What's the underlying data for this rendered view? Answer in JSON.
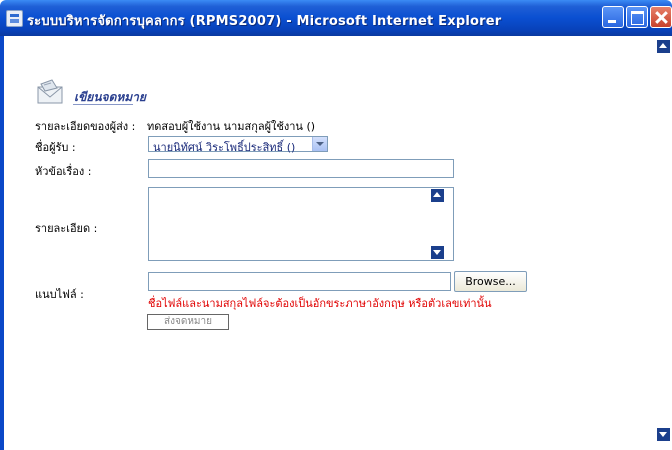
{
  "window": {
    "title": "ระบบบริหารจัดการบุคลากร (RPMS2007) - Microsoft Internet Explorer"
  },
  "page": {
    "heading": "เขียนจดหมาย",
    "sender": {
      "label": "รายละเอียดของผู้ส่ง :",
      "value": "ทดสอบผู้ใช้งาน นามสกุลผู้ใช้งาน ()"
    },
    "recipient": {
      "label": "ชื่อผู้รับ :",
      "selected": "นายนิทัศน์ วิระโพธิ์ประสิทธิ์ ()"
    },
    "subject": {
      "label": "หัวข้อเรื่อง :",
      "value": ""
    },
    "detail": {
      "label": "รายละเอียด :",
      "value": ""
    },
    "attachment": {
      "label": "แนบไฟล์ :",
      "value": "",
      "browse_label": "Browse...",
      "note": "ชื่อไฟล์และนามสกุลไฟล์จะต้องเป็นอักขระภาษาอังกฤษ หรือตัวเลขเท่านั้น"
    },
    "send_label": "ส่งจดหมาย"
  },
  "colors": {
    "titlebar": "#0a4fd1",
    "note_red": "#e00000",
    "heading": "#2a3f8f"
  }
}
